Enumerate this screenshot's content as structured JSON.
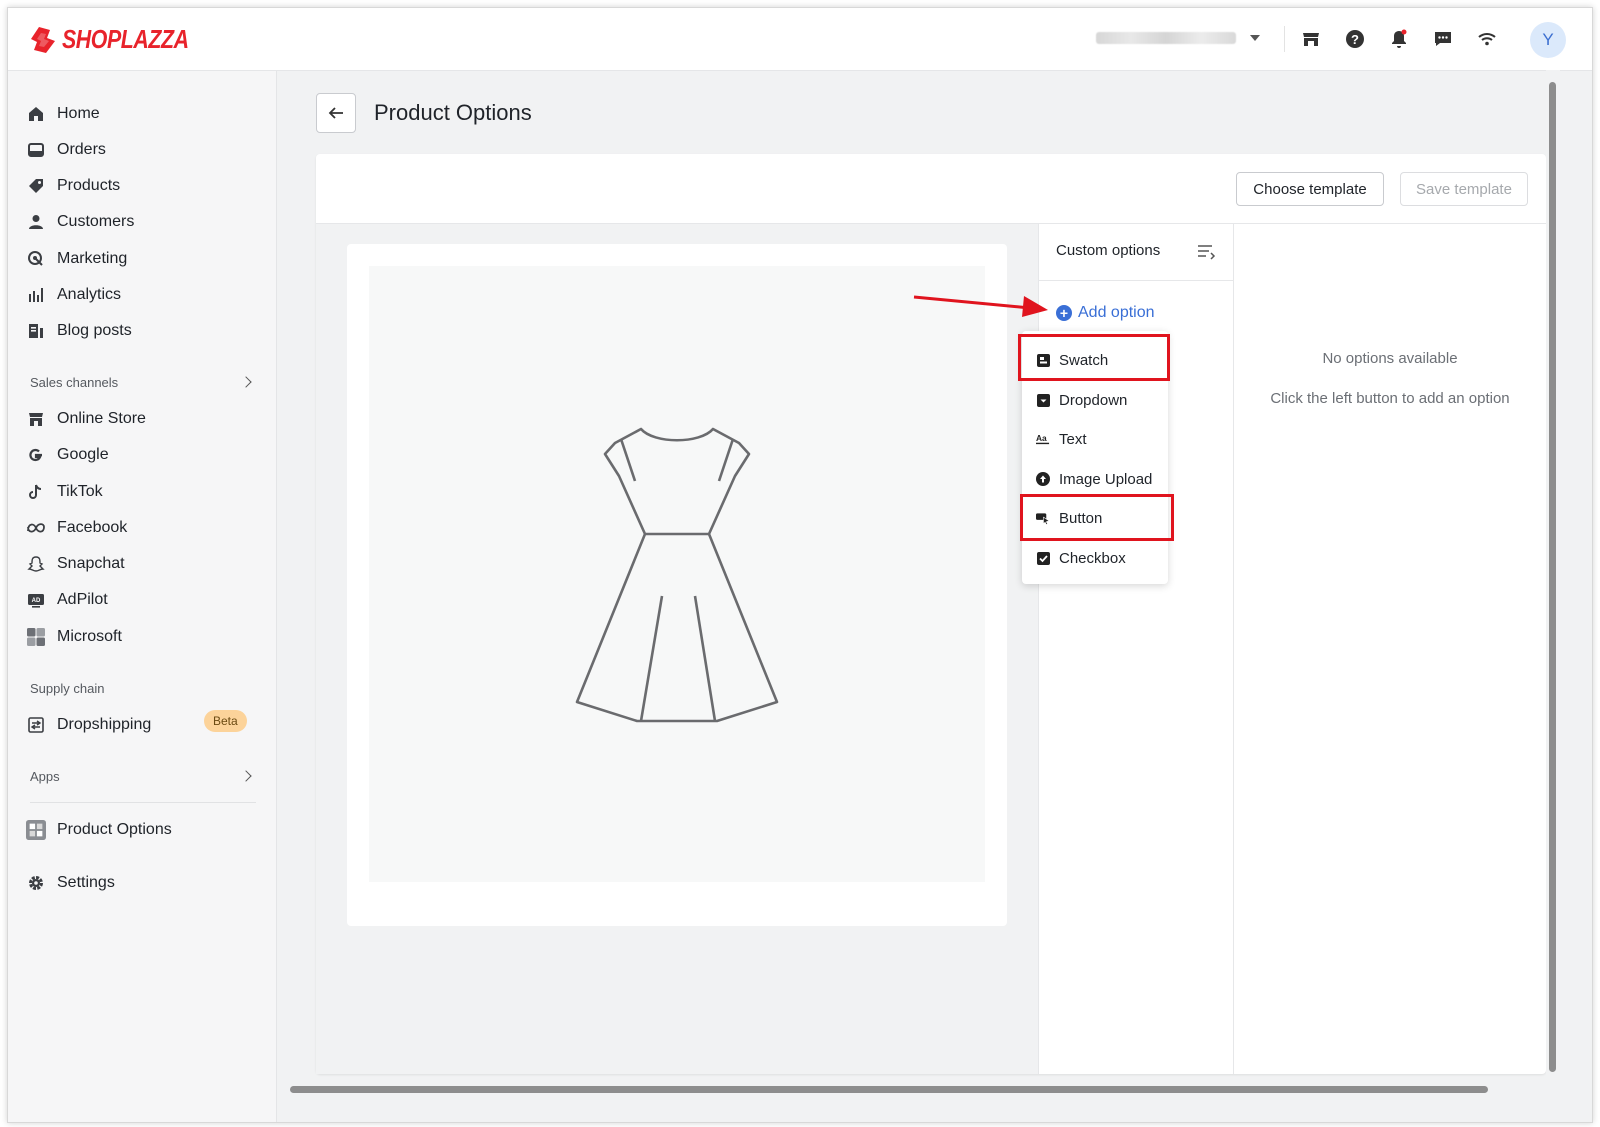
{
  "brand": {
    "name": "SHOPLAZZA",
    "color": "#e8232b"
  },
  "header": {
    "icons": [
      "storefront-icon",
      "help-icon",
      "bell-icon",
      "chat-icon",
      "wifi-icon"
    ],
    "avatar_initial": "Y"
  },
  "sidebar": {
    "main": [
      {
        "label": "Home",
        "icon": "home-icon"
      },
      {
        "label": "Orders",
        "icon": "orders-icon"
      },
      {
        "label": "Products",
        "icon": "tag-icon"
      },
      {
        "label": "Customers",
        "icon": "person-icon"
      },
      {
        "label": "Marketing",
        "icon": "marketing-icon"
      },
      {
        "label": "Analytics",
        "icon": "bar-chart-icon"
      },
      {
        "label": "Blog posts",
        "icon": "blog-icon"
      }
    ],
    "sales_channels_title": "Sales channels",
    "channels": [
      {
        "label": "Online Store",
        "icon": "store-icon"
      },
      {
        "label": "Google",
        "icon": "google-icon"
      },
      {
        "label": "TikTok",
        "icon": "tiktok-icon"
      },
      {
        "label": "Facebook",
        "icon": "meta-icon"
      },
      {
        "label": "Snapchat",
        "icon": "snapchat-icon"
      },
      {
        "label": "AdPilot",
        "icon": "ad-icon"
      },
      {
        "label": "Microsoft",
        "icon": "microsoft-icon"
      }
    ],
    "supply_chain_title": "Supply chain",
    "dropshipping": {
      "label": "Dropshipping",
      "badge": "Beta"
    },
    "apps_title": "Apps",
    "product_options": "Product Options",
    "settings": "Settings"
  },
  "page": {
    "title": "Product Options"
  },
  "toolbar": {
    "choose_template": "Choose template",
    "save_template": "Save template"
  },
  "options_panel": {
    "title": "Custom options",
    "add_option": "Add option",
    "menu": [
      {
        "label": "Swatch",
        "icon": "swatch-icon"
      },
      {
        "label": "Dropdown",
        "icon": "dropdown-icon"
      },
      {
        "label": "Text",
        "icon": "text-icon"
      },
      {
        "label": "Image Upload",
        "icon": "upload-icon"
      },
      {
        "label": "Button",
        "icon": "button-icon"
      },
      {
        "label": "Checkbox",
        "icon": "checkbox-icon"
      }
    ]
  },
  "empty_state": {
    "title": "No options available",
    "subtitle": "Click the left button to add an option"
  },
  "colors": {
    "accent": "#3a6fd6",
    "highlight": "#e0141e",
    "badge": "#fcd39a"
  }
}
